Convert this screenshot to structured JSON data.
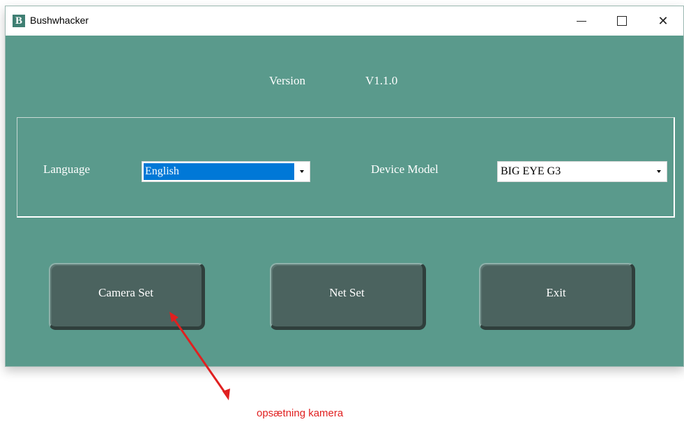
{
  "window": {
    "title": "Bushwhacker",
    "icon_letter": "B",
    "controls": {
      "minimize": "minimize-icon",
      "maximize": "maximize-icon",
      "close": "close-icon"
    }
  },
  "version": {
    "label": "Version",
    "value": "V1.1.0"
  },
  "settings": {
    "language_label": "Language",
    "language_value": "English",
    "device_model_label": "Device Model",
    "device_model_value": "BIG EYE G3"
  },
  "buttons": {
    "camera_set": "Camera Set",
    "net_set": "Net Set",
    "exit": "Exit"
  },
  "annotation": {
    "text": "opsætning kamera",
    "color": "#e02020"
  },
  "colors": {
    "background": "#5a9a8c",
    "button": "#4b635f",
    "selection": "#0078d7"
  }
}
